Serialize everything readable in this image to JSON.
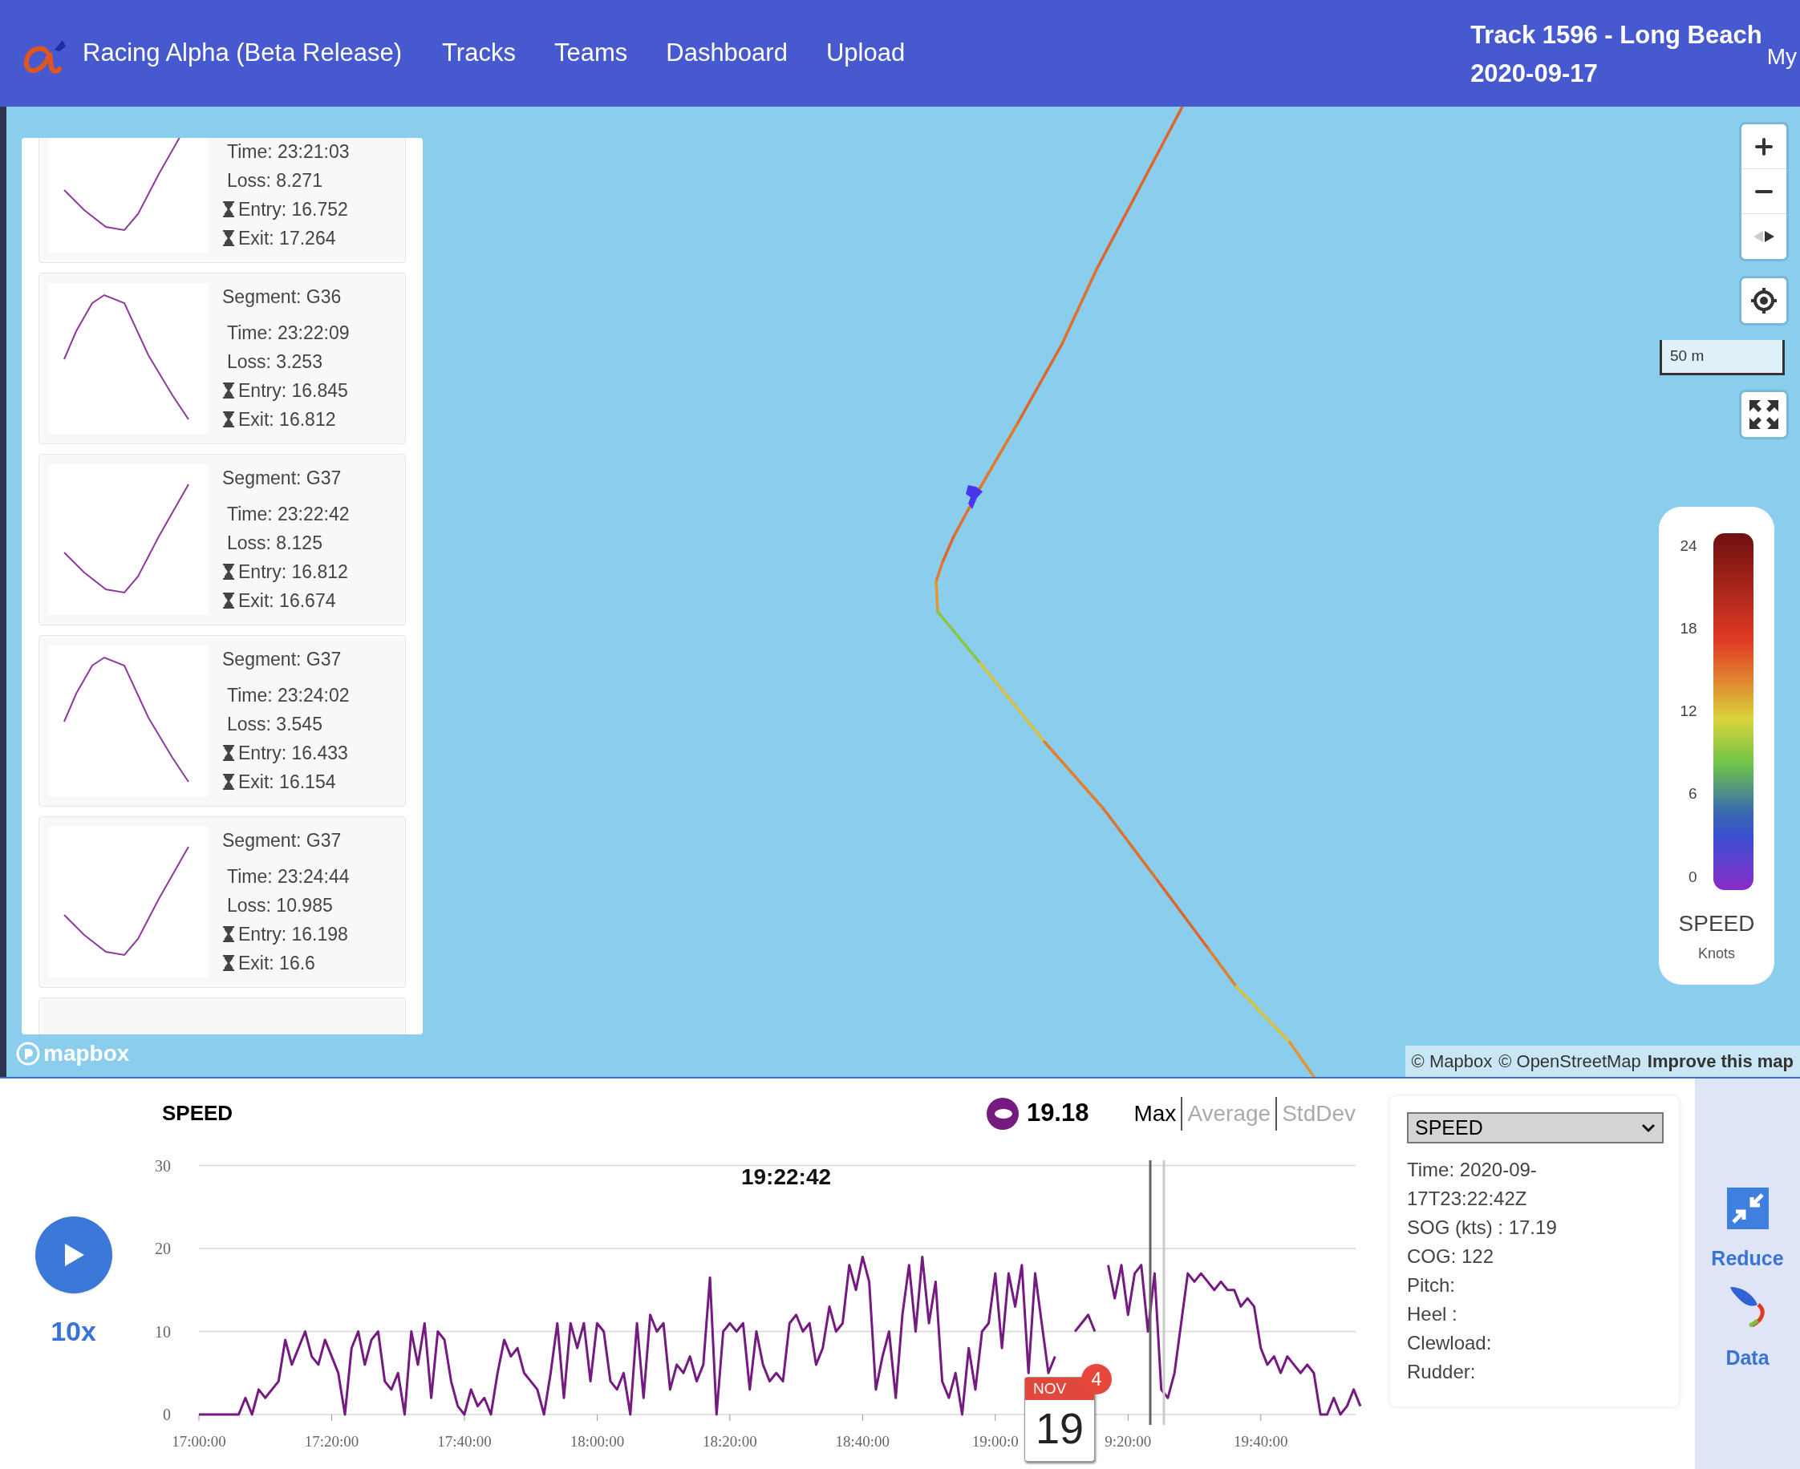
{
  "header": {
    "brand": "Racing Alpha (Beta Release)",
    "nav": [
      {
        "label": "Tracks"
      },
      {
        "label": "Teams"
      },
      {
        "label": "Dashboard"
      },
      {
        "label": "Upload"
      }
    ],
    "track_title": "Track 1596 - Long Beach",
    "track_date": "2020-09-17",
    "user_menu": "My"
  },
  "segments": [
    {
      "kind": "valley",
      "time": "Time: 23:21:03",
      "loss": "Loss: 8.271",
      "entry": "Entry: 16.752",
      "exit": "Exit: 17.264"
    },
    {
      "kind": "peak",
      "segment": "Segment: G36",
      "time": "Time: 23:22:09",
      "loss": "Loss: 3.253",
      "entry": "Entry: 16.845",
      "exit": "Exit: 16.812"
    },
    {
      "kind": "valley",
      "segment": "Segment: G37",
      "time": "Time: 23:22:42",
      "loss": "Loss: 8.125",
      "entry": "Entry: 16.812",
      "exit": "Exit: 16.674"
    },
    {
      "kind": "peak",
      "segment": "Segment: G37",
      "time": "Time: 23:24:02",
      "loss": "Loss: 3.545",
      "entry": "Entry: 16.433",
      "exit": "Exit: 16.154"
    },
    {
      "kind": "valley",
      "segment": "Segment: G37",
      "time": "Time: 23:24:44",
      "loss": "Loss: 10.985",
      "entry": "Entry: 16.198",
      "exit": "Exit: 16.6"
    }
  ],
  "map": {
    "scale": "50 m",
    "legend": {
      "ticks": [
        "24",
        "18",
        "12",
        "6",
        "0"
      ],
      "title": "SPEED",
      "unit": "Knots"
    },
    "logo": "mapbox",
    "attribution": [
      "© Mapbox",
      "© OpenStreetMap"
    ],
    "improve_link": "Improve this map"
  },
  "player": {
    "speed": "10x"
  },
  "chart_panel": {
    "stat_value": "19.18",
    "stat_tabs": [
      {
        "label": "Max",
        "selected": true
      },
      {
        "label": "Average",
        "selected": false
      },
      {
        "label": "StdDev",
        "selected": false
      }
    ],
    "chart_data": {
      "type": "line",
      "title": "SPEED",
      "ylim": [
        0,
        30
      ],
      "yticks": [
        0,
        10,
        20,
        30
      ],
      "categories": [
        "17:00:00",
        null,
        null,
        null,
        null,
        null,
        null,
        null,
        null,
        null,
        null,
        null,
        null,
        null,
        null,
        null,
        null,
        null,
        null,
        null,
        "17:20:00",
        null,
        null,
        null,
        null,
        null,
        null,
        null,
        null,
        null,
        null,
        null,
        null,
        null,
        null,
        null,
        null,
        null,
        null,
        null,
        "17:40:00",
        null,
        null,
        null,
        null,
        null,
        null,
        null,
        null,
        null,
        null,
        null,
        null,
        null,
        null,
        null,
        null,
        null,
        null,
        null,
        "18:00:00",
        null,
        null,
        null,
        null,
        null,
        null,
        null,
        null,
        null,
        null,
        null,
        null,
        null,
        null,
        null,
        null,
        null,
        null,
        null,
        "18:20:00",
        null,
        null,
        null,
        null,
        null,
        null,
        null,
        null,
        null,
        null,
        null,
        null,
        null,
        null,
        null,
        null,
        null,
        null,
        null,
        "18:40:00",
        null,
        null,
        null,
        null,
        null,
        null,
        null,
        null,
        null,
        null,
        null,
        null,
        null,
        null,
        null,
        null,
        null,
        null,
        null,
        "19:00:0",
        null,
        null,
        null,
        null,
        null,
        null,
        null,
        null,
        null,
        null,
        null,
        null,
        null,
        null,
        null,
        null,
        null,
        null,
        null,
        "9:20:00",
        null,
        null,
        null,
        null,
        null,
        null,
        null,
        null,
        null,
        null,
        null,
        null,
        null,
        null,
        null,
        null,
        null,
        null,
        null,
        "19:40:00",
        null,
        null,
        null,
        null,
        null,
        null,
        null,
        null,
        null,
        null,
        null,
        null,
        null,
        null,
        null
      ],
      "series": [
        {
          "color": "#751a80",
          "values": [
            0,
            0,
            0,
            0,
            0,
            0,
            0,
            2,
            0,
            3,
            2,
            3,
            4,
            9,
            6,
            8,
            10,
            7,
            6,
            9,
            7,
            5,
            0,
            8,
            10,
            6,
            9,
            10,
            4,
            3,
            5,
            0,
            10,
            6,
            11,
            2,
            10,
            9,
            4,
            1,
            0,
            3,
            1,
            2,
            0,
            5,
            9,
            7,
            8,
            5,
            4,
            3,
            0,
            5,
            11,
            2,
            11,
            8,
            11,
            4,
            11,
            10,
            4,
            3,
            5,
            0,
            11,
            2,
            12,
            10,
            11,
            3,
            6,
            5,
            7,
            4,
            6,
            16.5,
            0,
            10,
            11,
            10,
            11,
            3,
            10,
            6,
            4,
            5,
            4,
            11,
            12,
            10,
            11,
            6,
            8,
            13,
            10,
            11,
            18,
            15,
            19,
            16,
            3,
            7,
            10,
            2,
            12,
            18,
            10,
            19,
            11,
            16,
            4,
            2,
            5,
            0,
            8,
            3,
            10,
            11,
            17,
            8,
            17,
            13,
            18,
            5,
            17,
            11,
            5,
            7,
            null,
            null,
            10,
            11,
            12,
            10,
            null,
            18,
            14,
            18,
            12,
            17,
            18,
            10,
            17,
            3,
            2,
            5,
            11,
            17,
            16,
            17,
            16,
            15,
            16,
            15,
            15,
            13,
            14,
            13,
            8,
            6,
            7,
            5,
            7,
            6,
            5,
            6,
            5,
            0,
            0,
            2,
            0,
            1,
            3,
            1
          ]
        }
      ],
      "annotations": [
        "19:22:42"
      ]
    }
  },
  "calendar_icon": {
    "month": "NOV",
    "day": "19",
    "badge": "4"
  },
  "info": {
    "select": "SPEED",
    "lines": [
      "Time: 2020-09-17T23:22:42Z",
      "SOG (kts) : 17.19",
      "COG: 122",
      "Pitch:",
      "Heel :",
      "Clewload:",
      "Rudder:"
    ]
  },
  "side_actions": [
    {
      "kind": "reduce",
      "label": "Reduce"
    },
    {
      "kind": "data",
      "label": "Data"
    }
  ]
}
